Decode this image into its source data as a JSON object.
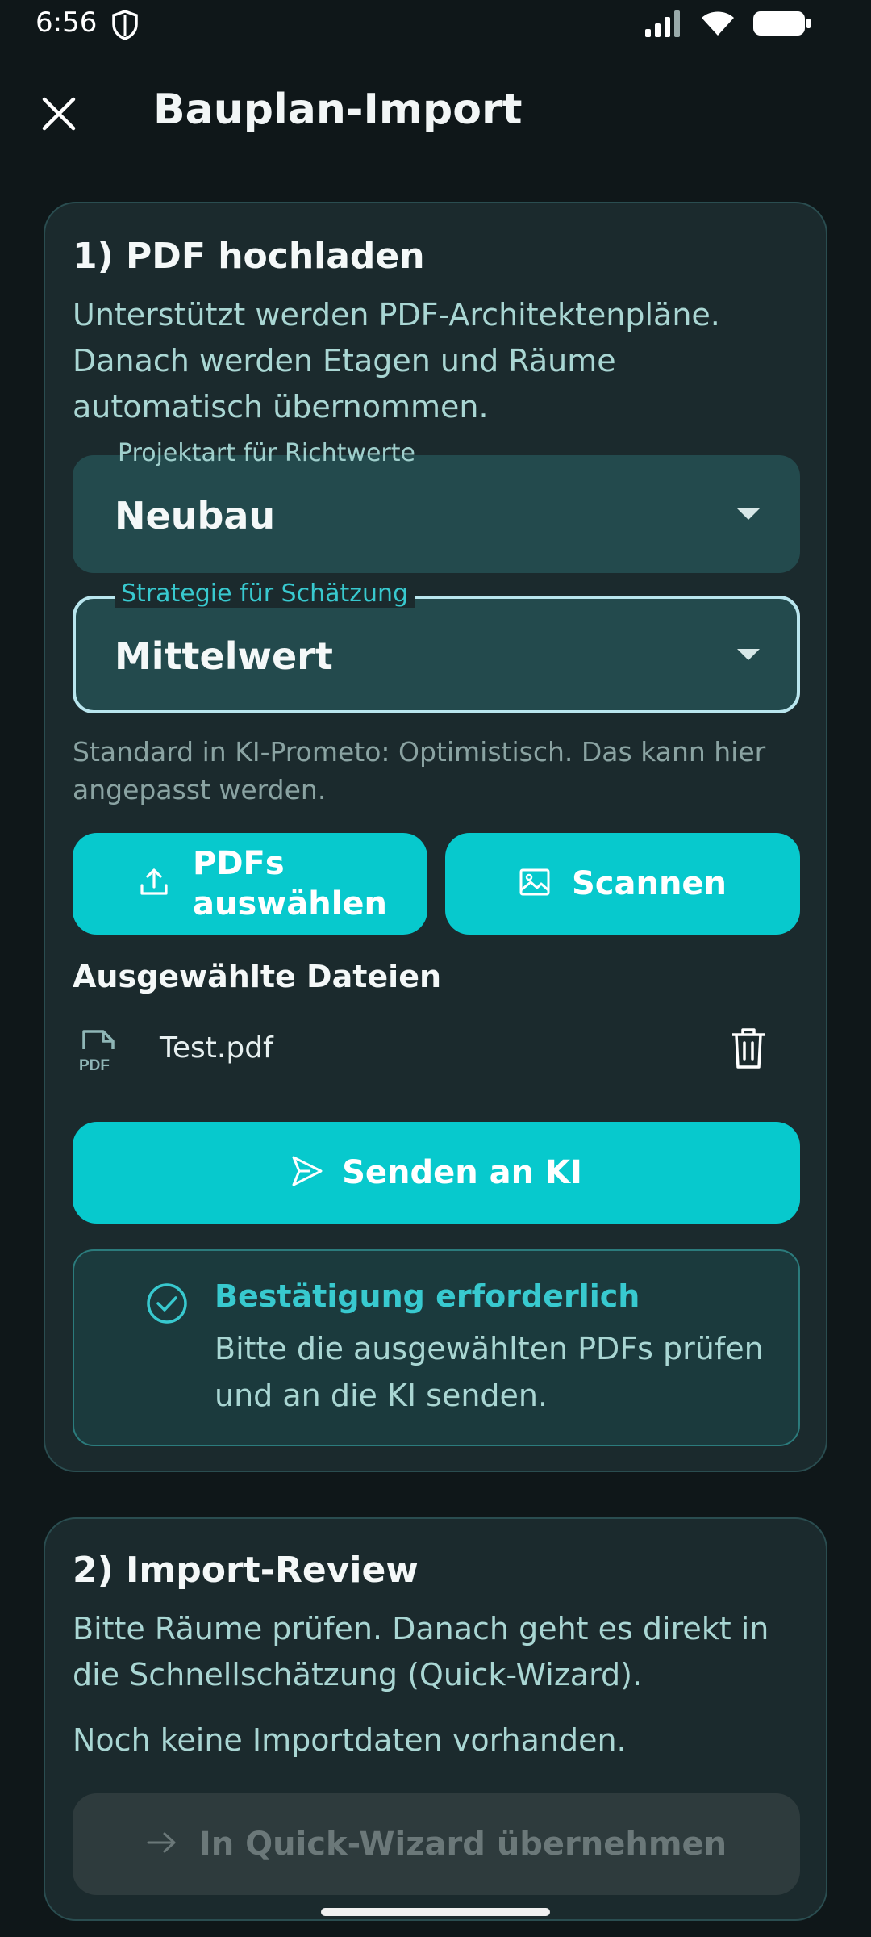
{
  "status": {
    "time": "6:56"
  },
  "appbar": {
    "title": "Bauplan-Import"
  },
  "upload": {
    "title": "1) PDF hochladen",
    "description": "Unterstützt werden PDF-Architektenpläne. Danach werden Etagen und Räume automatisch übernommen.",
    "project_select": {
      "label": "Projektart für Richtwerte",
      "value": "Neubau"
    },
    "strategy_select": {
      "label": "Strategie für Schätzung",
      "value": "Mittelwert"
    },
    "hint": "Standard in KI-Prometo: Optimistisch. Das kann hier angepasst werden.",
    "choose_button": "PDFs auswählen",
    "scan_button": "Scannen",
    "selected_heading": "Ausgewählte Dateien",
    "file_icon_label": "PDF",
    "files": [
      {
        "name": "Test.pdf"
      }
    ],
    "send_button": "Senden an KI",
    "confirmation": {
      "title": "Bestätigung erforderlich",
      "text": "Bitte die ausgewählten PDFs prüfen und an die KI senden."
    }
  },
  "review": {
    "title": "2) Import-Review",
    "description": "Bitte Räume prüfen. Danach geht es direkt in die Schnellschätzung (Quick-Wizard).",
    "empty": "Noch keine Importdaten vorhanden.",
    "apply_button": "In Quick-Wizard übernehmen"
  },
  "colors": {
    "accent": "#07c9cd",
    "background": "#0f1719",
    "card": "#1b2a2d"
  }
}
